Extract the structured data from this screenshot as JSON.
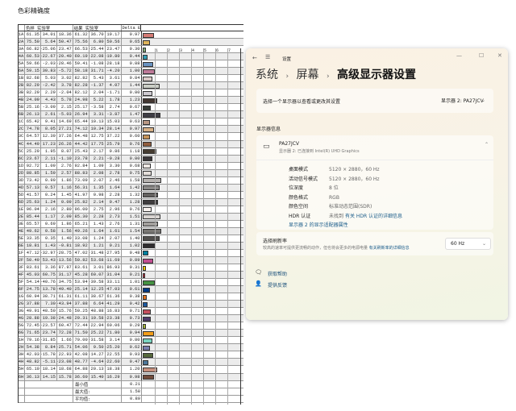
{
  "title": "色彩精确度",
  "table": {
    "headers": [
      "",
      "色样 实验室",
      "",
      "",
      "结果 实验室",
      "",
      "",
      "Delta E"
    ],
    "chart_ticks": [
      "1",
      "2",
      "3",
      "4",
      "5",
      "6",
      "7"
    ],
    "rows": [
      [
        "1A",
        "61.35",
        "34.01",
        "18.36",
        "61.32",
        "36.70",
        "19.17",
        "0.97"
      ],
      [
        "2A",
        "75.50",
        "5.64",
        "50.47",
        "75.56",
        "6.80",
        "50.56",
        "0.65"
      ],
      [
        "3A",
        "66.82",
        "-25.06",
        "23.47",
        "66.53",
        "-25.44",
        "23.47",
        "0.30"
      ],
      [
        "4A",
        "60.53",
        "-22.67",
        "-20.40",
        "60.19",
        "-22.08",
        "-19.80",
        "0.44"
      ],
      [
        "5A",
        "59.66",
        "-2.03",
        "-28.46",
        "59.41",
        "-1.08",
        "-28.18",
        "0.88"
      ],
      [
        "6A",
        "59.15",
        "30.83",
        "-5.72",
        "58.18",
        "31.71",
        "-4.20",
        "1.00"
      ],
      [
        "1B",
        "82.68",
        "5.03",
        "3.02",
        "82.82",
        "5.43",
        "3.61",
        "0.84"
      ],
      [
        "2B",
        "82.29",
        "-2.42",
        "3.78",
        "82.28",
        "-1.37",
        "4.07",
        "1.44"
      ],
      [
        "3B",
        "82.29",
        "2.29",
        "-2.04",
        "82.12",
        "2.04",
        "-1.71",
        "0.80"
      ],
      [
        "4B",
        "24.09",
        "4.43",
        "5.78",
        "24.98",
        "5.22",
        "1.78",
        "1.23"
      ],
      [
        "5B",
        "25.16",
        "-3.09",
        "2.15",
        "25.17",
        "-3.58",
        "2.74",
        "0.67"
      ],
      [
        "6B",
        "26.13",
        "2.61",
        "-5.03",
        "26.94",
        "3.31",
        "-3.87",
        "1.47"
      ],
      [
        "1C",
        "65.42",
        "9.41",
        "14.69",
        "65.44",
        "10.13",
        "15.03",
        "0.63"
      ],
      [
        "2C",
        "74.78",
        "8.05",
        "27.21",
        "74.12",
        "10.34",
        "28.14",
        "0.97"
      ],
      [
        "3C",
        "64.57",
        "12.39",
        "37.26",
        "64.48",
        "12.75",
        "37.22",
        "0.60"
      ],
      [
        "4C",
        "44.49",
        "17.23",
        "26.26",
        "44.42",
        "17.75",
        "25.79",
        "0.76"
      ],
      [
        "5C",
        "25.29",
        "1.95",
        "8.07",
        "25.43",
        "2.17",
        "9.86",
        "1.18"
      ],
      [
        "6C",
        "23.67",
        "2.11",
        "-1.10",
        "23.78",
        "2.21",
        "-0.28",
        "0.80"
      ],
      [
        "1D",
        "92.72",
        "1.09",
        "2.76",
        "92.84",
        "1.09",
        "3.30",
        "0.68"
      ],
      [
        "2D",
        "88.85",
        "1.59",
        "2.57",
        "88.83",
        "2.08",
        "2.78",
        "0.75"
      ],
      [
        "3D",
        "73.42",
        "0.99",
        "1.86",
        "73.09",
        "2.07",
        "2.46",
        "1.58"
      ],
      [
        "4D",
        "57.13",
        "0.57",
        "1.16",
        "56.31",
        "1.35",
        "1.64",
        "1.42"
      ],
      [
        "5D",
        "41.57",
        "0.24",
        "1.45",
        "41.97",
        "0.98",
        "2.28",
        "1.32"
      ],
      [
        "6D",
        "25.63",
        "1.24",
        "0.09",
        "25.82",
        "2.14",
        "0.47",
        "1.28"
      ],
      [
        "1E",
        "96.04",
        "2.16",
        "2.80",
        "96.00",
        "2.75",
        "2.96",
        "0.76"
      ],
      [
        "2E",
        "85.44",
        "1.17",
        "2.09",
        "85.30",
        "2.28",
        "2.73",
        "1.51"
      ],
      [
        "3E",
        "65.57",
        "0.69",
        "1.86",
        "65.21",
        "1.43",
        "2.76",
        "1.31"
      ],
      [
        "4E",
        "49.62",
        "0.58",
        "1.56",
        "49.26",
        "1.64",
        "1.61",
        "1.54"
      ],
      [
        "5E",
        "33.35",
        "0.35",
        "1.40",
        "33.08",
        "1.24",
        "2.07",
        "1.40"
      ],
      [
        "6E",
        "18.81",
        "1.43",
        "-0.81",
        "18.92",
        "1.21",
        "0.21",
        "1.02"
      ],
      [
        "1F",
        "47.12",
        "-32.97",
        "-28.75",
        "47.02",
        "-31.48",
        "-27.95",
        "0.48"
      ],
      [
        "2F",
        "50.49",
        "53.43",
        "-13.56",
        "50.82",
        "53.68",
        "-11.69",
        "0.89"
      ],
      [
        "3F",
        "83.61",
        "3.36",
        "87.97",
        "83.61",
        "3.01",
        "86.93",
        "0.31"
      ],
      [
        "4F",
        "45.03",
        "60.75",
        "31.17",
        "45.28",
        "60.07",
        "31.04",
        "0.21"
      ],
      [
        "5F",
        "54.14",
        "-40.76",
        "34.75",
        "53.94",
        "-39.58",
        "33.11",
        "1.01"
      ],
      [
        "6F",
        "24.75",
        "13.78",
        "-49.40",
        "25.14",
        "12.25",
        "-47.03",
        "0.61"
      ],
      [
        "1G",
        "60.94",
        "38.71",
        "61.31",
        "61.11",
        "38.67",
        "61.36",
        "0.38"
      ],
      [
        "2G",
        "37.88",
        "7.30",
        "-43.94",
        "37.88",
        "6.64",
        "-41.29",
        "0.42"
      ],
      [
        "3G",
        "49.91",
        "48.50",
        "15.76",
        "50.25",
        "48.88",
        "16.83",
        "0.71"
      ],
      [
        "4G",
        "28.88",
        "19.38",
        "-24.48",
        "29.31",
        "19.58",
        "-23.38",
        "0.73"
      ],
      [
        "5G",
        "72.45",
        "-23.57",
        "60.47",
        "72.44",
        "-22.94",
        "60.06",
        "0.29"
      ],
      [
        "6G",
        "71.65",
        "23.74",
        "72.28",
        "71.50",
        "25.22",
        "71.80",
        "0.94"
      ],
      [
        "1H",
        "79.16",
        "-31.85",
        "1.66",
        "79.00",
        "-31.58",
        "3.14",
        "0.80"
      ],
      [
        "2H",
        "54.38",
        "8.84",
        "-25.71",
        "54.06",
        "9.50",
        "-25.20",
        "0.62"
      ],
      [
        "3H",
        "42.03",
        "-15.78",
        "22.93",
        "42.08",
        "-14.27",
        "22.55",
        "0.93"
      ],
      [
        "4H",
        "48.82",
        "-5.11",
        "-23.08",
        "48.77",
        "-4.64",
        "-22.60",
        "0.47"
      ],
      [
        "5H",
        "65.10",
        "18.14",
        "18.68",
        "64.88",
        "20.13",
        "18.38",
        "1.20"
      ],
      [
        "6H",
        "36.13",
        "14.15",
        "15.78",
        "36.60",
        "15.40",
        "16.29",
        "0.98"
      ]
    ],
    "summary": [
      [
        "最小值",
        "0.21"
      ],
      [
        "最大值:",
        "1.58"
      ],
      [
        "平均值:",
        "0.80"
      ]
    ]
  },
  "settings": {
    "app_title": "设置",
    "breadcrumb": [
      "系统",
      "屏幕",
      "高级显示器设置"
    ],
    "select_label": "选择一个显示器以查看或更改其设置",
    "select_value": "显示器 2: PA27JCV",
    "section": "显示器信息",
    "monitor_name": "PA27JCV",
    "monitor_sub": "显示器 2: 已连接到 Intel(R) UHD Graphics",
    "info": [
      {
        "k": "桌面模式",
        "v": "5120 × 2880，60 Hz"
      },
      {
        "k": "活动信号模式",
        "v": "5120 × 2880，60 Hz"
      },
      {
        "k": "位深度",
        "v": "8 位"
      },
      {
        "k": "颜色格式",
        "v": "RGB"
      },
      {
        "k": "颜色空间",
        "v": "标准动态范围(SDR)"
      },
      {
        "k": "HDR 认证",
        "v": "未找到"
      }
    ],
    "hdr_link": "有关 HDR 认证的详细信息",
    "adapter_link": "显示器 2 的显示适配器属性",
    "refresh_title": "选择刷新率",
    "refresh_desc": "较高的速率可提供更流畅的动作，但也将会更多的电源电量",
    "refresh_link": "有关刷新率的详细信息",
    "refresh_value": "60 Hz",
    "help": "获取帮助",
    "feedback": "提供反馈"
  }
}
